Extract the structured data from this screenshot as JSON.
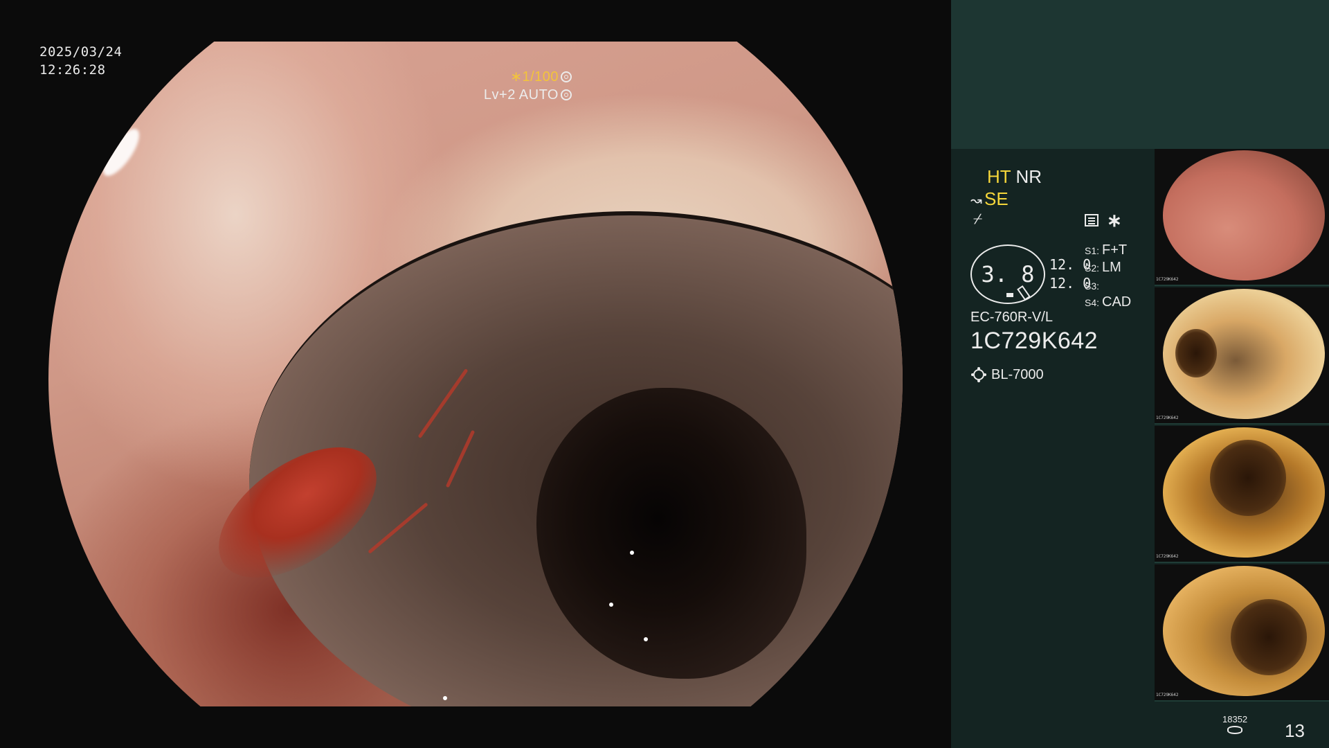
{
  "overlay": {
    "date": "2025/03/24",
    "time": "12:26:28",
    "shutter": "∗1/100",
    "level": "Lv+2",
    "mode": "AUTO"
  },
  "panel": {
    "ht": "HT",
    "nr": "NR",
    "se": "SE",
    "se_icon": "↝",
    "hatch_icon": "⌿",
    "asterisk": "∗",
    "ring_value": "3. 8",
    "value_a": "12. 0",
    "value_b": "12. 0",
    "s_keys": [
      "S1:",
      "S2:",
      "S3:",
      "S4:"
    ],
    "s_values": [
      "F+T",
      "LM",
      "",
      "CAD"
    ],
    "scope_model": "EC-760R-V/L",
    "scope_serial": "1C729K642",
    "light_source": "BL-7000"
  },
  "thumbnails": [
    {
      "caption": "1C729K642"
    },
    {
      "caption": "1C729K642"
    },
    {
      "caption": "1C729K642"
    },
    {
      "caption": "1C729K642"
    }
  ],
  "footer": {
    "storage_count": "18352",
    "frame_count": "13"
  },
  "colors": {
    "highlight_yellow": "#f5d63a",
    "panel_bg": "#142422",
    "panel_top_bg": "#1d3632"
  }
}
